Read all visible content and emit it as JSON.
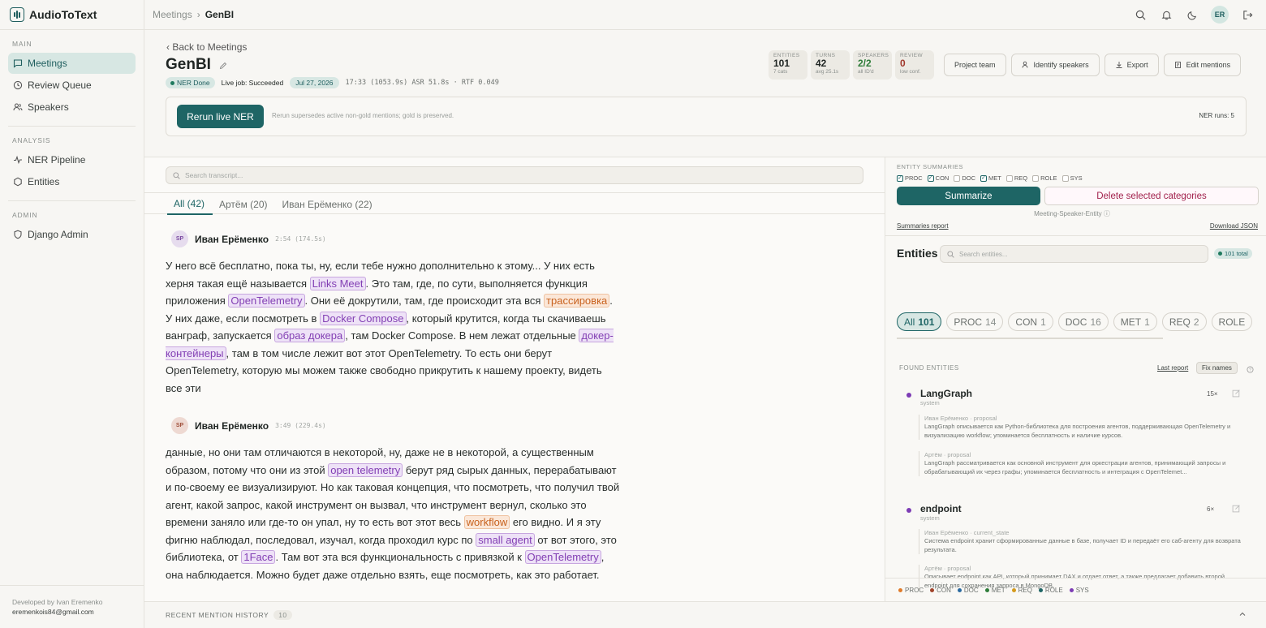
{
  "app": {
    "name": "AudioToText"
  },
  "breadcrumb": {
    "parent": "Meetings",
    "sep": "›",
    "current": "GenBI"
  },
  "user": {
    "initials": "ER"
  },
  "sidebar": {
    "main_title": "MAIN",
    "main_items": [
      {
        "label": "Meetings",
        "icon": "message-icon",
        "active": true
      },
      {
        "label": "Review Queue",
        "icon": "clock-icon"
      },
      {
        "label": "Speakers",
        "icon": "users-icon"
      }
    ],
    "analysis_title": "ANALYSIS",
    "analysis_items": [
      {
        "label": "NER Pipeline",
        "icon": "pulse-icon"
      },
      {
        "label": "Entities",
        "icon": "hexagon-icon"
      }
    ],
    "admin_title": "ADMIN",
    "admin_items": [
      {
        "label": "Django Admin",
        "icon": "shield-icon"
      }
    ],
    "developer": "Developed by Ivan Eremenko",
    "email": "eremenkois84@gmail.com"
  },
  "meeting": {
    "back": "Back to Meetings",
    "title": "GenBI",
    "status": "NER Done",
    "live_job": "Live job: Succeeded",
    "date": "Jul 27, 2026",
    "info": "17:33 (1053.9s) ASR 51.8s · RTF 0.049"
  },
  "stats": [
    {
      "label": "ENTITIES",
      "value": "101",
      "sub": "7 cats",
      "color": "#1f2523"
    },
    {
      "label": "TURNS",
      "value": "42",
      "sub": "avg 25.1s",
      "color": "#1f2523"
    },
    {
      "label": "SPEAKERS",
      "value": "2/2",
      "sub": "all ID'd",
      "color": "#2f7d3a"
    },
    {
      "label": "REVIEW",
      "value": "0",
      "sub": "low conf.",
      "color": "#a0372b"
    }
  ],
  "actions": {
    "project_team": "Project team",
    "identify": "Identify speakers",
    "export": "Export",
    "edit_mentions": "Edit mentions"
  },
  "rerun": {
    "button": "Rerun live NER",
    "note": "Rerun supersedes active non-gold mentions; gold is preserved.",
    "runs": "NER runs: 5"
  },
  "transcript": {
    "search_placeholder": "Search transcript...",
    "tabs": [
      "All (42)",
      "Артём (20)",
      "Иван Ерёменко (22)"
    ],
    "turn1": {
      "initials": "SP",
      "speaker": "Иван Ерёменко",
      "time": "2:54 (174.5s)"
    },
    "turn2": {
      "initials": "SP",
      "speaker": "Иван Ерёменко",
      "time": "3:49 (229.4s)"
    }
  },
  "recent": {
    "label": "RECENT MENTION HISTORY",
    "count": "10"
  },
  "summaries": {
    "title": "ENTITY SUMMARIES",
    "categories": [
      {
        "label": "PROC",
        "checked": true
      },
      {
        "label": "CON",
        "checked": true
      },
      {
        "label": "DOC",
        "checked": false
      },
      {
        "label": "MET",
        "checked": true
      },
      {
        "label": "REQ",
        "checked": false
      },
      {
        "label": "ROLE",
        "checked": false
      },
      {
        "label": "SYS",
        "checked": false
      }
    ],
    "summarize": "Summarize",
    "delete": "Delete selected categories",
    "mode": "Meeting-Speaker-Entity",
    "report": "Summaries report",
    "download": "Download JSON"
  },
  "entities": {
    "title": "Entities",
    "search_placeholder": "Search entities...",
    "total": "101 total",
    "pills": [
      {
        "label": "All",
        "count": "101"
      },
      {
        "label": "PROC",
        "count": "14"
      },
      {
        "label": "CON",
        "count": "1"
      },
      {
        "label": "DOC",
        "count": "16"
      },
      {
        "label": "MET",
        "count": "1"
      },
      {
        "label": "REQ",
        "count": "2"
      },
      {
        "label": "ROLE",
        "count": ""
      }
    ],
    "found_title": "FOUND ENTITIES",
    "last_report": "Last report",
    "fix_names": "Fix names",
    "items": [
      {
        "name": "LangGraph",
        "type": "system",
        "count": "15×",
        "quotes": [
          {
            "head": "Иван Ерёменко · proposal",
            "body": "LangGraph описывается как Python-библиотека для построения агентов, поддерживающая OpenTelemetry и визуализацию workflow; упоминается бесплатность и наличие курсов."
          },
          {
            "head": "Артём · proposal",
            "body": "LangGraph рассматривается как основной инструмент для оркестрации агентов, принимающий запросы и обрабатывающий их через графы; упоминается бесплатность и интеграция с OpenTelemet..."
          }
        ]
      },
      {
        "name": "endpoint",
        "type": "system",
        "count": "6×",
        "quotes": [
          {
            "head": "Иван Ерёменко · current_state",
            "body": "Система endpoint хранит сформированные данные в базе, получает ID и передаёт его саб-агенту для возврата результата."
          },
          {
            "head": "Артём · proposal",
            "body": "Описывает endpoint как API, который принимает DAX и отдает ответ, а также предлагает добавить второй endpoint для сохранения запроса в MongoDB."
          }
        ]
      }
    ]
  },
  "legend": [
    {
      "label": "PROC",
      "color": "#e07b2a"
    },
    {
      "label": "CON",
      "color": "#a0432a"
    },
    {
      "label": "DOC",
      "color": "#2a6aa0"
    },
    {
      "label": "MET",
      "color": "#2f7d3a"
    },
    {
      "label": "REQ",
      "color": "#d49a1c"
    },
    {
      "label": "ROLE",
      "color": "#1e6565"
    },
    {
      "label": "SYS",
      "color": "#7d3cb5"
    }
  ]
}
